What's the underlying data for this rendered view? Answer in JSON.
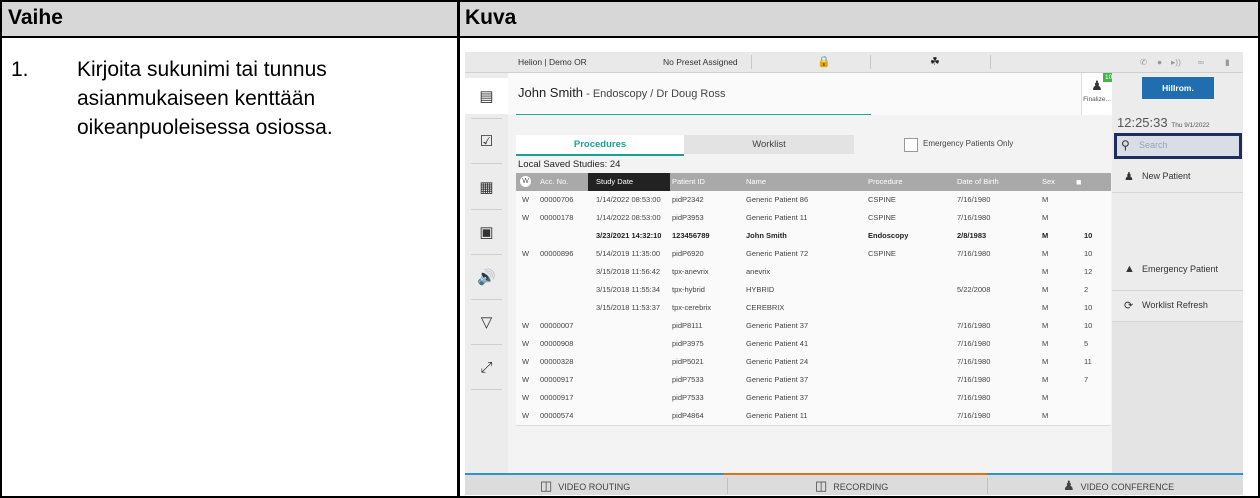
{
  "table": {
    "col_step": "Vaihe",
    "col_image": "Kuva",
    "step_number": "1.",
    "step_text": "Kirjoita sukunimi tai tunnus asianmukaiseen kenttään oikeanpuoleisessa osiossa."
  },
  "screen": {
    "topbar": {
      "room": "Helion | Demo OR",
      "preset": "No Preset Assigned"
    },
    "header": {
      "patient": "John Smith",
      "detail": " - Endoscopy / Dr Doug Ross",
      "finalize_label": "Finalize...",
      "badge_count": "10"
    },
    "tabs": {
      "procedures": "Procedures",
      "worklist": "Worklist"
    },
    "emergency_only_label": "Emergency Patients Only",
    "local_saved": "Local Saved Studies: 24",
    "columns": [
      "W",
      "Acc. No.",
      "Study Date",
      "Patient ID",
      "Name",
      "Procedure",
      "Date of Birth",
      "Sex",
      ""
    ],
    "rows": [
      {
        "w": "W",
        "acc": "00000706",
        "date": "1/14/2022 08:53:00",
        "pid": "pidP2342",
        "name": "Generic Patient 86",
        "proc": "CSPINE",
        "dob": "7/16/1980",
        "sex": "M",
        "cnt": ""
      },
      {
        "w": "W",
        "acc": "00000178",
        "date": "1/14/2022 08:53:00",
        "pid": "pidP3953",
        "name": "Generic Patient 11",
        "proc": "CSPINE",
        "dob": "7/16/1980",
        "sex": "M",
        "cnt": ""
      },
      {
        "w": "",
        "acc": "",
        "date": "3/23/2021 14:32:10",
        "pid": "123456789",
        "name": "John Smith",
        "proc": "Endoscopy",
        "dob": "2/8/1983",
        "sex": "M",
        "cnt": "10"
      },
      {
        "w": "W",
        "acc": "00000896",
        "date": "5/14/2019 11:35:00",
        "pid": "pidP6920",
        "name": "Generic Patient 72",
        "proc": "CSPINE",
        "dob": "7/16/1980",
        "sex": "M",
        "cnt": "10"
      },
      {
        "w": "",
        "acc": "",
        "date": "3/15/2018 11:56:42",
        "pid": "tpx-anevrix",
        "name": "anevrix",
        "proc": "",
        "dob": "",
        "sex": "M",
        "cnt": "12"
      },
      {
        "w": "",
        "acc": "",
        "date": "3/15/2018 11:55:34",
        "pid": "tpx-hybrid",
        "name": "HYBRID",
        "proc": "",
        "dob": "5/22/2008",
        "sex": "M",
        "cnt": "2"
      },
      {
        "w": "",
        "acc": "",
        "date": "3/15/2018 11:53:37",
        "pid": "tpx-cerebrix",
        "name": "CEREBRIX",
        "proc": "",
        "dob": "",
        "sex": "M",
        "cnt": "10"
      },
      {
        "w": "W",
        "acc": "00000007",
        "date": "",
        "pid": "pidP8111",
        "name": "Generic Patient 37",
        "proc": "",
        "dob": "7/16/1980",
        "sex": "M",
        "cnt": "10"
      },
      {
        "w": "W",
        "acc": "00000908",
        "date": "",
        "pid": "pidP3975",
        "name": "Generic Patient 41",
        "proc": "",
        "dob": "7/16/1980",
        "sex": "M",
        "cnt": "5"
      },
      {
        "w": "W",
        "acc": "00000328",
        "date": "",
        "pid": "pidP5021",
        "name": "Generic Patient 24",
        "proc": "",
        "dob": "7/16/1980",
        "sex": "M",
        "cnt": "11"
      },
      {
        "w": "W",
        "acc": "00000917",
        "date": "",
        "pid": "pidP7533",
        "name": "Generic Patient 37",
        "proc": "",
        "dob": "7/16/1980",
        "sex": "M",
        "cnt": "7"
      },
      {
        "w": "W",
        "acc": "00000917",
        "date": "",
        "pid": "pidP7533",
        "name": "Generic Patient 37",
        "proc": "",
        "dob": "7/16/1980",
        "sex": "M",
        "cnt": ""
      },
      {
        "w": "W",
        "acc": "00000574",
        "date": "",
        "pid": "pidP4864",
        "name": "Generic Patient 11",
        "proc": "",
        "dob": "7/16/1980",
        "sex": "M",
        "cnt": ""
      }
    ],
    "right": {
      "logo": "Hillrom.",
      "clock": "12:25:33",
      "date": "Thu 9/1/2022",
      "search_placeholder": "Search",
      "new_patient": "New Patient",
      "emergency_patient": "Emergency Patient",
      "worklist_refresh": "Worklist Refresh"
    },
    "bottom": {
      "video_routing": "VIDEO ROUTING",
      "recording": "RECORDING",
      "video_conference": "VIDEO CONFERENCE"
    },
    "colors": {
      "accent": "#1ba098",
      "highlight": "#1c2d5e",
      "brand": "#1f6fb0"
    }
  }
}
